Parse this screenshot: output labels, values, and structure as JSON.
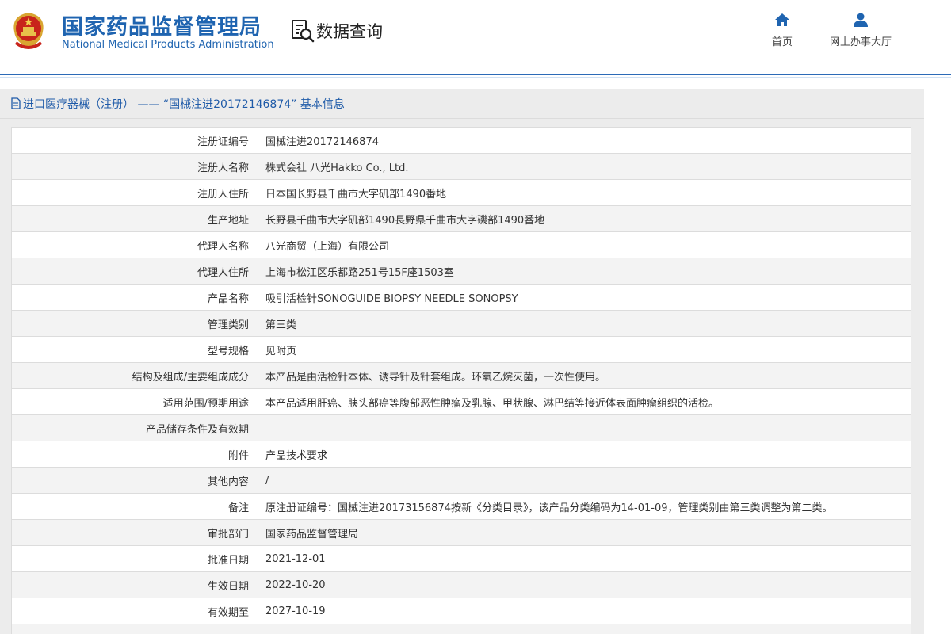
{
  "header": {
    "title_cn": "国家药品监督管理局",
    "title_en": "National Medical Products Administration",
    "query_label": "数据查询",
    "nav": [
      {
        "label": "首页",
        "icon": "home-icon"
      },
      {
        "label": "网上办事大厅",
        "icon": "user-icon"
      }
    ],
    "brand_color": "#1f64b0"
  },
  "panel": {
    "title": "进口医疗器械（注册） —— “国械注进20172146874” 基本信息"
  },
  "rows": [
    {
      "label": "注册证编号",
      "value": "国械注进20172146874"
    },
    {
      "label": "注册人名称",
      "value": "株式会社 八光Hakko Co., Ltd."
    },
    {
      "label": "注册人住所",
      "value": "日本国长野县千曲市大字矶部1490番地"
    },
    {
      "label": "生产地址",
      "value": "长野县千曲市大字矶部1490長野県千曲市大字磯部1490番地"
    },
    {
      "label": "代理人名称",
      "value": "八光商贸（上海）有限公司"
    },
    {
      "label": "代理人住所",
      "value": "上海市松江区乐都路251号15F座1503室"
    },
    {
      "label": "产品名称",
      "value": "吸引活检针SONOGUIDE BIOPSY NEEDLE SONOPSY"
    },
    {
      "label": "管理类别",
      "value": "第三类"
    },
    {
      "label": "型号规格",
      "value": "见附页"
    },
    {
      "label": "结构及组成/主要组成成分",
      "value": "本产品是由活检针本体、诱导针及针套组成。环氧乙烷灭菌，一次性使用。"
    },
    {
      "label": "适用范围/预期用途",
      "value": "本产品适用肝癌、胰头部癌等腹部恶性肿瘤及乳腺、甲状腺、淋巴结等接近体表面肿瘤组织的活检。"
    },
    {
      "label": "产品储存条件及有效期",
      "value": ""
    },
    {
      "label": "附件",
      "value": "产品技术要求"
    },
    {
      "label": "其他内容",
      "value": "/"
    },
    {
      "label": "备注",
      "value": "原注册证编号：国械注进20173156874按新《分类目录》，该产品分类编码为14-01-09，管理类别由第三类调整为第二类。"
    },
    {
      "label": "审批部门",
      "value": "国家药品监督管理局"
    },
    {
      "label": "批准日期",
      "value": "2021-12-01"
    },
    {
      "label": "生效日期",
      "value": "2022-10-20"
    },
    {
      "label": "有效期至",
      "value": "2027-10-19"
    },
    {
      "label": "",
      "value": ""
    }
  ]
}
